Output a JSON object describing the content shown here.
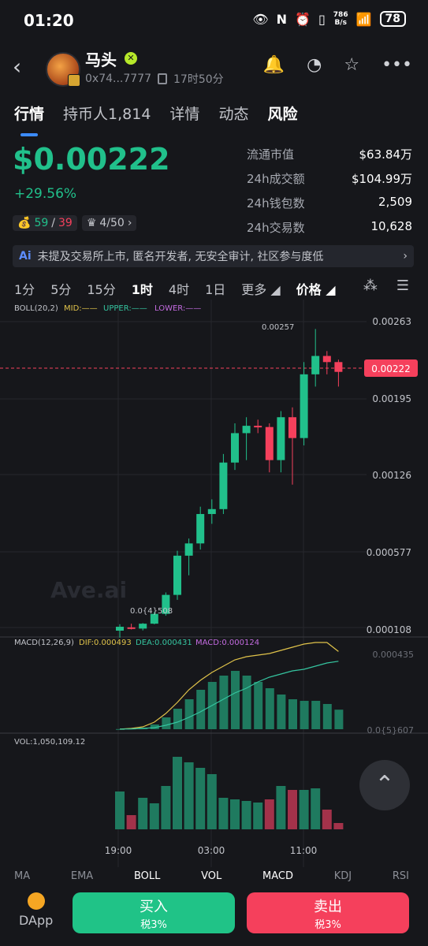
{
  "status_bar": {
    "time": "01:20",
    "net_speed_top": "786",
    "net_speed_bottom": "B/s",
    "battery": "78"
  },
  "header": {
    "token_name": "马头",
    "address": "0x74...7777",
    "age": "17时50分"
  },
  "tabs": [
    {
      "label": "行情",
      "active": true
    },
    {
      "label": "持币人1,814",
      "active": false
    },
    {
      "label": "详情",
      "active": false
    },
    {
      "label": "动态",
      "active": false
    },
    {
      "label": "风险",
      "active": false
    }
  ],
  "price": {
    "value": "$0.00222",
    "change": "+29.56%",
    "color": "#21c08b"
  },
  "chips": {
    "holders_a": "59",
    "holders_b": "39",
    "rank": "4/50"
  },
  "stats": [
    {
      "label": "流通市值",
      "value": "$63.84万"
    },
    {
      "label": "24h成交额",
      "value": "$104.99万"
    },
    {
      "label": "24h钱包数",
      "value": "2,509"
    },
    {
      "label": "24h交易数",
      "value": "10,628"
    }
  ],
  "ai_banner": {
    "tag": "Ai",
    "text": "未提及交易所上市, 匿名开发者, 无安全审计, 社区参与度低"
  },
  "timeframes": [
    {
      "label": "1分",
      "active": false
    },
    {
      "label": "5分",
      "active": false
    },
    {
      "label": "15分",
      "active": false
    },
    {
      "label": "1时",
      "active": true
    },
    {
      "label": "4时",
      "active": false
    },
    {
      "label": "1日",
      "active": false
    },
    {
      "label": "更多",
      "active": false
    },
    {
      "label": "价格",
      "active": false
    }
  ],
  "boll": {
    "label": "BOLL(20,2)",
    "mid": "MID:——",
    "upper": "UPPER:——",
    "lower": "LOWER:——"
  },
  "macd_label": {
    "title": "MACD(12,26,9)",
    "dif": "DIF:0.000493",
    "dea": "DEA:0.000431",
    "macd": "MACD:0.000124"
  },
  "vol_label": "VOL:1,050,109.12",
  "watermark": "Ave.ai",
  "bottom_tabs": [
    "MA",
    "EMA",
    "BOLL",
    "VOL",
    "MACD",
    "KDJ",
    "RSI"
  ],
  "actions": {
    "dapp": "DApp",
    "buy": "买入",
    "buy_tax": "税3%",
    "sell": "卖出",
    "sell_tax": "税3%"
  },
  "colors": {
    "up": "#21c08b",
    "down": "#f5405c",
    "accent": "#3c8cff",
    "dif": "#e0c34a",
    "dea": "#35c5a0"
  },
  "chart_data": [
    {
      "type": "candlestick",
      "title": "",
      "price_axis": [
        "0.00263",
        "0.00195",
        "0.00126",
        "0.000577",
        "0.000108"
      ],
      "time_axis": [
        "19:00",
        "03:00",
        "11:00"
      ],
      "current_price": "0.00222",
      "high_label": "0.00257",
      "low_label": "0.0{4}508",
      "candles": [
        {
          "o": 0.000108,
          "h": 0.00016,
          "l": 5.1e-05,
          "c": 0.00014
        },
        {
          "o": 0.000135,
          "h": 0.000165,
          "l": 0.000118,
          "c": 0.000125
        },
        {
          "o": 0.000125,
          "h": 0.00017,
          "l": 0.00011,
          "c": 0.000165
        },
        {
          "o": 0.000165,
          "h": 0.00026,
          "l": 0.00016,
          "c": 0.000245
        },
        {
          "o": 0.000245,
          "h": 0.00042,
          "l": 0.00023,
          "c": 0.0004
        },
        {
          "o": 0.0004,
          "h": 0.00076,
          "l": 0.00036,
          "c": 0.00072
        },
        {
          "o": 0.00072,
          "h": 0.00086,
          "l": 0.00056,
          "c": 0.00082
        },
        {
          "o": 0.00082,
          "h": 0.00112,
          "l": 0.00077,
          "c": 0.00106
        },
        {
          "o": 0.00106,
          "h": 0.00118,
          "l": 0.00098,
          "c": 0.0011
        },
        {
          "o": 0.0011,
          "h": 0.00155,
          "l": 0.00106,
          "c": 0.00148
        },
        {
          "o": 0.00148,
          "h": 0.0018,
          "l": 0.00142,
          "c": 0.00172
        },
        {
          "o": 0.00172,
          "h": 0.00185,
          "l": 0.0015,
          "c": 0.00178
        },
        {
          "o": 0.00178,
          "h": 0.00183,
          "l": 0.00172,
          "c": 0.00177
        },
        {
          "o": 0.00177,
          "h": 0.0018,
          "l": 0.0014,
          "c": 0.0015
        },
        {
          "o": 0.0015,
          "h": 0.0019,
          "l": 0.0014,
          "c": 0.00185
        },
        {
          "o": 0.00185,
          "h": 0.00193,
          "l": 0.0013,
          "c": 0.00168
        },
        {
          "o": 0.00168,
          "h": 0.0023,
          "l": 0.00162,
          "c": 0.0022
        },
        {
          "o": 0.0022,
          "h": 0.00257,
          "l": 0.0021,
          "c": 0.00235
        },
        {
          "o": 0.00235,
          "h": 0.00239,
          "l": 0.0022,
          "c": 0.0023
        },
        {
          "o": 0.0023,
          "h": 0.00232,
          "l": 0.0021,
          "c": 0.00222
        }
      ]
    },
    {
      "type": "bar",
      "title": "",
      "y_axis": [
        "0.000435",
        "0.0{5}607"
      ],
      "hist": [
        1e-06,
        4e-06,
        1e-05,
        3e-05,
        7.5e-05,
        0.00013,
        0.00019,
        0.00025,
        0.0003,
        0.00034,
        0.00037,
        0.00034,
        0.0003,
        0.00026,
        0.00022,
        0.00019,
        0.00018,
        0.00018,
        0.00016,
        0.000124
      ],
      "dif": [
        1e-06,
        5e-06,
        1.5e-05,
        4.5e-05,
        0.0001,
        0.00017,
        0.00025,
        0.00031,
        0.00036,
        0.0004,
        0.00044,
        0.00046,
        0.00047,
        0.00048,
        0.0005,
        0.00052,
        0.00054,
        0.00055,
        0.00055,
        0.000493
      ],
      "dea": [
        1e-06,
        2e-06,
        5e-06,
        1e-05,
        2.5e-05,
        4.5e-05,
        7.5e-05,
        0.00011,
        0.00015,
        0.00019,
        0.00023,
        0.00026,
        0.0003,
        0.00033,
        0.00035,
        0.00037,
        0.00038,
        0.0004,
        0.00042,
        0.000431
      ]
    },
    {
      "type": "bar",
      "title": "",
      "volume": [
        {
          "v": 0.48,
          "up": true
        },
        {
          "v": 0.18,
          "up": false
        },
        {
          "v": 0.4,
          "up": true
        },
        {
          "v": 0.33,
          "up": true
        },
        {
          "v": 0.55,
          "up": true
        },
        {
          "v": 0.92,
          "up": true
        },
        {
          "v": 0.85,
          "up": true
        },
        {
          "v": 0.78,
          "up": true
        },
        {
          "v": 0.7,
          "up": true
        },
        {
          "v": 0.4,
          "up": true
        },
        {
          "v": 0.38,
          "up": true
        },
        {
          "v": 0.36,
          "up": true
        },
        {
          "v": 0.34,
          "up": true
        },
        {
          "v": 0.38,
          "up": false
        },
        {
          "v": 0.55,
          "up": true
        },
        {
          "v": 0.5,
          "up": false
        },
        {
          "v": 0.5,
          "up": true
        },
        {
          "v": 0.52,
          "up": true
        },
        {
          "v": 0.25,
          "up": false
        },
        {
          "v": 0.08,
          "up": false
        }
      ]
    }
  ]
}
